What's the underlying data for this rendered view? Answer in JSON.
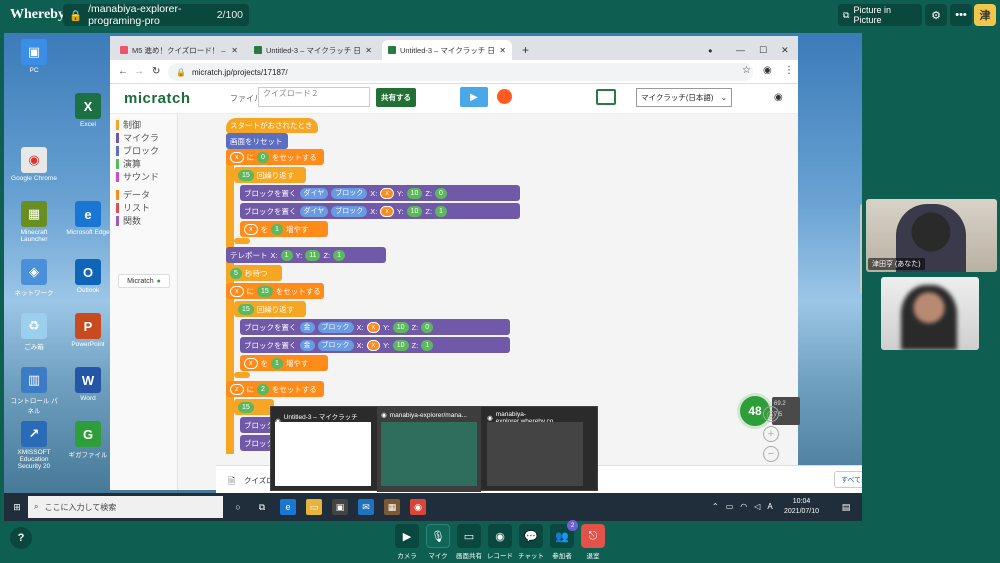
{
  "whereby": {
    "brand": "Whereby",
    "room": "/manabiya-explorer-programing-pro",
    "count": "2/100",
    "pip_label": "Picture in Picture",
    "avatar_initial": "津",
    "help": "?"
  },
  "controls": [
    {
      "label": "カメラ",
      "icon": "camera-icon"
    },
    {
      "label": "マイク",
      "icon": "mic-icon"
    },
    {
      "label": "画面共有",
      "icon": "screen-share-icon"
    },
    {
      "label": "レコード",
      "icon": "record-icon"
    },
    {
      "label": "チャット",
      "icon": "chat-icon"
    },
    {
      "label": "参加者",
      "icon": "people-icon",
      "badge": "2"
    },
    {
      "label": "退室",
      "icon": "leave-icon"
    }
  ],
  "participants": [
    {
      "name": "津田亨 (あなた)"
    },
    {
      "name": ""
    }
  ],
  "desktop": {
    "icons": [
      {
        "label": "PC",
        "glyph": "▣",
        "color": "#3a8ee6"
      },
      {
        "label": "Google Chrome",
        "glyph": "◉",
        "color": "#e8e8e8"
      },
      {
        "label": "Minecraft Launcher",
        "glyph": "▦",
        "color": "#6b8e23"
      },
      {
        "label": "ネットワーク",
        "glyph": "◈",
        "color": "#4a90d9"
      },
      {
        "label": "ごみ箱",
        "glyph": "♻",
        "color": "#9ccfee"
      },
      {
        "label": "コントロール パネル",
        "glyph": "▥",
        "color": "#3c7cc4"
      },
      {
        "label": "XMISSOFT Education Security 20",
        "glyph": "↗",
        "color": "#2a6bb8"
      },
      {
        "label": "Excel",
        "glyph": "X",
        "color": "#1d7044"
      },
      {
        "label": "Microsoft Edge",
        "glyph": "e",
        "color": "#1976d2"
      },
      {
        "label": "Outlook",
        "glyph": "O",
        "color": "#0f66b8"
      },
      {
        "label": "PowerPoint",
        "glyph": "P",
        "color": "#c84a1e"
      },
      {
        "label": "Word",
        "glyph": "W",
        "color": "#2455a6"
      },
      {
        "label": "ギガファイル",
        "glyph": "G",
        "color": "#2e9e3a"
      }
    ],
    "search_placeholder": "ここに入力して検索",
    "time": "10:04",
    "date": "2021/07/10"
  },
  "browser": {
    "tabs": [
      {
        "title": "M5 進め！クイズロード！ – 小中学生向け..."
      },
      {
        "title": "Untitled-3 – マイクラッチ 日本語"
      },
      {
        "title": "Untitled-3 – マイクラッチ 日本語"
      }
    ],
    "url": "micratch.jp/projects/17187/",
    "download_file": "クイズロード２ (1).txt",
    "show_all": "すべて表示"
  },
  "micratch": {
    "logo": "micratch",
    "file_label": "ファイル",
    "file_placeholder": "クイズロード２",
    "share_label": "共有する",
    "language": "マイクラッチ(日本語)",
    "badge": "Micratch",
    "categories": [
      {
        "label": "制御",
        "color": "#f6a623"
      },
      {
        "label": "マイクラ",
        "color": "#6f59a8"
      },
      {
        "label": "ブロック",
        "color": "#5b6ec2"
      },
      {
        "label": "演算",
        "color": "#5cb85c"
      },
      {
        "label": "サウンド",
        "color": "#c94fc9"
      },
      {
        "label": "データ",
        "color": "#ff8c1a"
      },
      {
        "label": "リスト",
        "color": "#d9534f"
      },
      {
        "label": "関数",
        "color": "#9a5bc5"
      }
    ],
    "blocks": {
      "start": "スタートがおされたとき",
      "reset": "画面をリセット",
      "x": "x",
      "z": "z",
      "ni": "に",
      "wo": "を",
      "set": "をセットする",
      "repeat": "回繰り返す",
      "place": "ブロックを置く",
      "diamond": "ダイヤ",
      "gold": "金",
      "block": "ブロック",
      "increase": "増やす",
      "teleport": "テレポート",
      "wait": "秒待つ",
      "X": "X:",
      "Y": "Y:",
      "Z": "Z:",
      "n0": "0",
      "n1": "1",
      "n2": "2",
      "n5": "5",
      "n10": "10",
      "n11": "11",
      "n15": "15"
    }
  },
  "taskbar_preview": [
    {
      "title": "Untitled-3 – マイクラッチ 日..."
    },
    {
      "title": "manabiya-explorer/mana..."
    },
    {
      "title": "manabiya-explorer.whereby.co..."
    }
  ],
  "zoom": {
    "percent": "48",
    "stat1": "69.2",
    "stat2": "7.5"
  }
}
